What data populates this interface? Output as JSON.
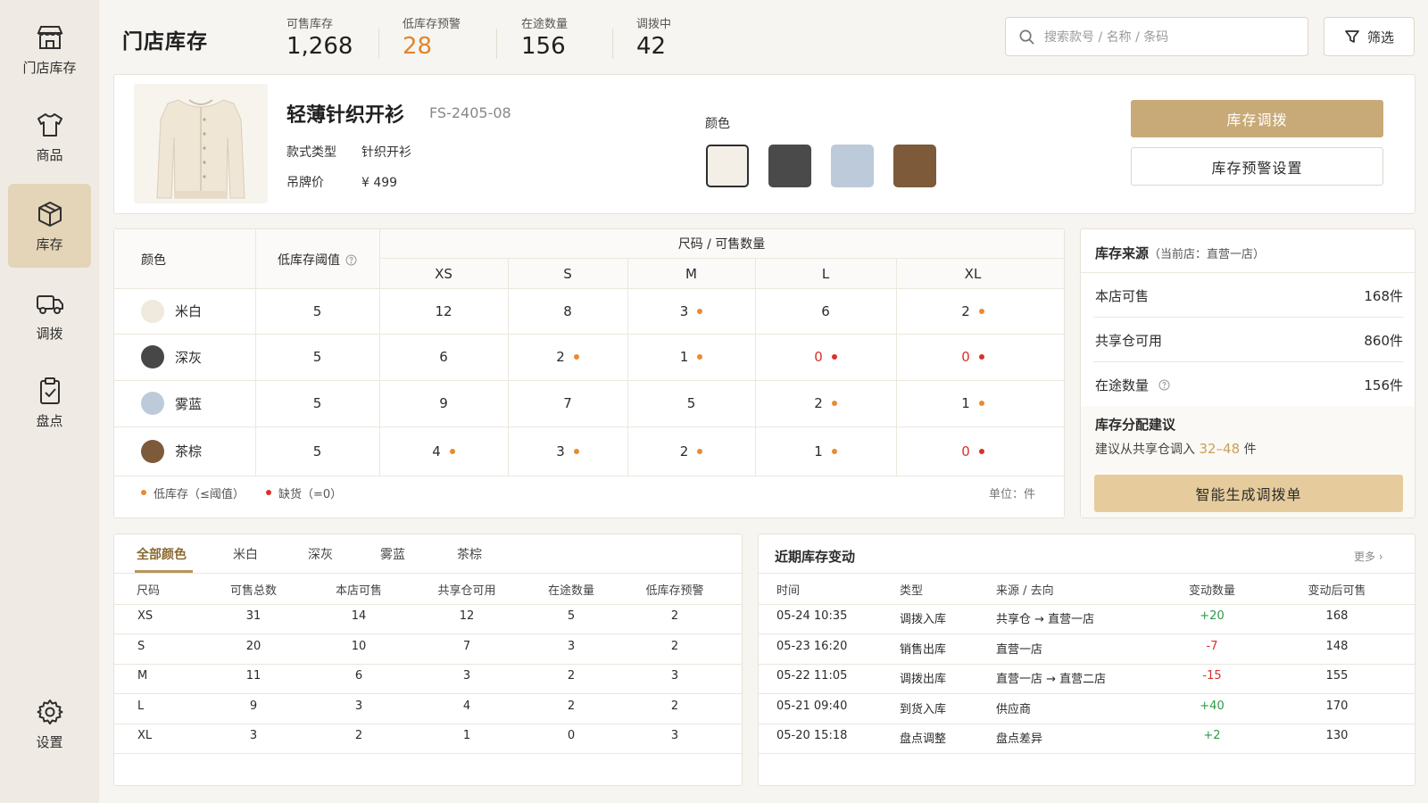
{
  "sidebar": {
    "items": [
      {
        "label": "门店库存",
        "icon": "store-icon"
      },
      {
        "label": "商品",
        "icon": "tshirt-icon"
      },
      {
        "label": "库存",
        "icon": "box-icon",
        "active": true
      },
      {
        "label": "调拨",
        "icon": "truck-icon"
      },
      {
        "label": "盘点",
        "icon": "clipboard-check-icon"
      },
      {
        "label": "设置",
        "icon": "gear-icon"
      }
    ]
  },
  "header": {
    "title": "门店库存",
    "stats": [
      {
        "label": "可售库存",
        "value": "1,268"
      },
      {
        "label": "低库存预警",
        "value": "28"
      },
      {
        "label": "在途数量",
        "value": "156"
      },
      {
        "label": "调拨中",
        "value": "42"
      }
    ],
    "search_placeholder": "搜索款号 / 名称 / 条码",
    "filter_label": "筛选"
  },
  "product": {
    "name": "轻薄针织开衫",
    "code": "FS-2405-08",
    "type_label": "款式类型",
    "type_value": "针织开衫",
    "price_label": "吊牌价",
    "price_value": "¥ 499",
    "color_title": "颜色",
    "swatches": [
      "#f3efe6",
      "#4a4a4a",
      "#bccad9",
      "#7c5a3a"
    ],
    "btn_transfer": "库存调拨",
    "btn_alert": "库存预警设置"
  },
  "matrix": {
    "col_color": "颜色",
    "col_threshold": "低库存阈值",
    "size_group": "尺码 / 可售数量",
    "sizes": [
      "XS",
      "S",
      "M",
      "L",
      "XL"
    ],
    "rows": [
      {
        "color": "米白",
        "swatch": "#efe9de",
        "threshold": "5",
        "values": [
          "12",
          "8",
          "3",
          "6",
          "2"
        ],
        "status": [
          "",
          "",
          "low",
          "",
          "low"
        ]
      },
      {
        "color": "深灰",
        "swatch": "#474747",
        "threshold": "5",
        "values": [
          "6",
          "2",
          "1",
          "0",
          "0"
        ],
        "status": [
          "",
          "low",
          "low",
          "out",
          "out"
        ]
      },
      {
        "color": "雾蓝",
        "swatch": "#bccad9",
        "threshold": "5",
        "values": [
          "9",
          "7",
          "5",
          "2",
          "1"
        ],
        "status": [
          "",
          "",
          "",
          "low",
          "low"
        ]
      },
      {
        "color": "茶棕",
        "swatch": "#7c5a3a",
        "threshold": "5",
        "values": [
          "4",
          "3",
          "2",
          "1",
          "0"
        ],
        "status": [
          "low",
          "low",
          "low",
          "low",
          "out"
        ]
      }
    ],
    "legend_low": "低库存（≤阈值）",
    "legend_out": "缺货（=0）",
    "unit": "单位：件"
  },
  "source": {
    "title": "库存来源",
    "subtitle": "（当前店：直营一店）",
    "rows": [
      {
        "label": "本店可售",
        "value": "168件"
      },
      {
        "label": "共享仓可用",
        "value": "860件"
      },
      {
        "label": "在途数量",
        "value": "156件"
      }
    ],
    "suggest_title": "库存分配建议",
    "suggest_prefix": "建议从共享仓调入",
    "suggest_range": "32–48",
    "suggest_suffix": "件",
    "btn": "智能生成调拨单"
  },
  "detail": {
    "tabs": [
      "全部颜色",
      "米白",
      "深灰",
      "雾蓝",
      "茶棕"
    ],
    "headers": [
      "尺码",
      "可售总数",
      "本店可售",
      "共享仓可用",
      "在途数量",
      "低库存预警"
    ],
    "rows": [
      [
        "XS",
        "31",
        "14",
        "12",
        "5",
        "2"
      ],
      [
        "S",
        "20",
        "10",
        "7",
        "3",
        "2"
      ],
      [
        "M",
        "11",
        "6",
        "3",
        "2",
        "3"
      ],
      [
        "L",
        "9",
        "3",
        "4",
        "2",
        "2"
      ],
      [
        "XL",
        "3",
        "2",
        "1",
        "0",
        "3"
      ]
    ]
  },
  "log": {
    "title": "近期库存变动",
    "more": "更多",
    "headers": [
      "时间",
      "类型",
      "来源 / 去向",
      "变动数量",
      "变动后可售"
    ],
    "rows": [
      {
        "time": "05-24 10:35",
        "type": "调拨入库",
        "route": "共享仓 → 直营一店",
        "delta": "+20",
        "after": "168"
      },
      {
        "time": "05-23 16:20",
        "type": "销售出库",
        "route": "直营一店",
        "delta": "-7",
        "after": "148"
      },
      {
        "time": "05-22 11:05",
        "type": "调拨出库",
        "route": "直营一店 → 直营二店",
        "delta": "-15",
        "after": "155"
      },
      {
        "time": "05-21 09:40",
        "type": "到货入库",
        "route": "供应商",
        "delta": "+40",
        "after": "170"
      },
      {
        "time": "05-20 15:18",
        "type": "盘点调整",
        "route": "盘点差异",
        "delta": "+2",
        "after": "130"
      }
    ]
  }
}
